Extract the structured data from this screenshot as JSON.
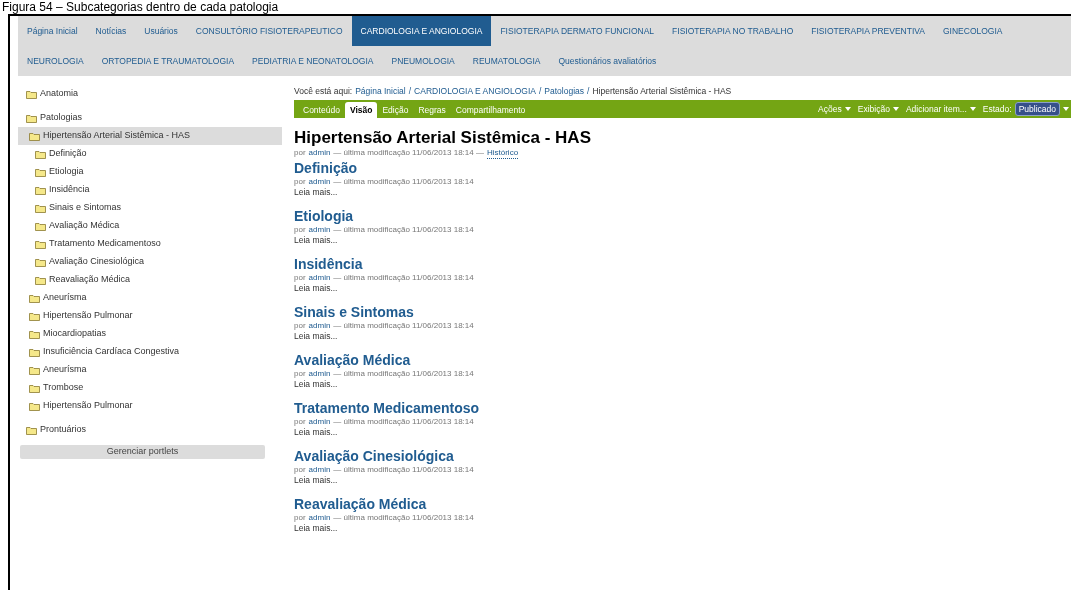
{
  "caption": "Figura 54 – Subcategorias dentro de cada patologia",
  "nav": [
    [
      {
        "label": "Página Inicial",
        "selected": false
      },
      {
        "label": "Notícias",
        "selected": false
      },
      {
        "label": "Usuários",
        "selected": false
      },
      {
        "label": "CONSULTÓRIO FISIOTERAPEUTICO",
        "selected": false
      },
      {
        "label": "CARDIOLOGIA E ANGIOLOGIA",
        "selected": true
      },
      {
        "label": "FISIOTERAPIA DERMATO FUNCIONAL",
        "selected": false
      },
      {
        "label": "FISIOTERAPIA NO TRABALHO",
        "selected": false
      },
      {
        "label": "FISIOTERAPIA PREVENTIVA",
        "selected": false
      },
      {
        "label": "GINECOLOGIA",
        "selected": false
      }
    ],
    [
      {
        "label": "NEUROLOGIA",
        "selected": false
      },
      {
        "label": "ORTOPEDIA E TRAUMATOLOGIA",
        "selected": false
      },
      {
        "label": "PEDIATRIA E NEONATOLOGIA",
        "selected": false
      },
      {
        "label": "PNEUMOLOGIA",
        "selected": false
      },
      {
        "label": "REUMATOLOGIA",
        "selected": false
      },
      {
        "label": "Questionários avaliatórios",
        "selected": false
      }
    ]
  ],
  "sidebar": {
    "tree": [
      {
        "label": "Anatomia",
        "selected": false
      },
      {
        "label": "Patologias",
        "selected": false,
        "children": [
          {
            "label": "Hipertensão Arterial Sistêmica - HAS",
            "selected": true,
            "children": [
              {
                "label": "Definição",
                "selected": false
              },
              {
                "label": "Etiologia",
                "selected": false
              },
              {
                "label": "Insidência",
                "selected": false
              },
              {
                "label": "Sinais e Sintomas",
                "selected": false
              },
              {
                "label": "Avaliação Médica",
                "selected": false
              },
              {
                "label": "Tratamento Medicamentoso",
                "selected": false
              },
              {
                "label": "Avaliação Cinesiológica",
                "selected": false
              },
              {
                "label": "Reavaliação Médica",
                "selected": false
              }
            ]
          },
          {
            "label": "Aneurísma",
            "selected": false
          },
          {
            "label": "Hipertensão Pulmonar",
            "selected": false
          },
          {
            "label": "Miocardiopatias",
            "selected": false
          },
          {
            "label": "Insuficiência Cardíaca Congestiva",
            "selected": false
          },
          {
            "label": "Aneurísma",
            "selected": false
          },
          {
            "label": "Trombose",
            "selected": false
          },
          {
            "label": "Hipertensão Pulmonar",
            "selected": false
          }
        ]
      },
      {
        "label": "Prontuários",
        "selected": false
      }
    ],
    "manage_button": "Gerenciar portlets"
  },
  "breadcrumb": {
    "label": "Você está aqui:",
    "links": [
      "Página Inicial",
      "CARDIOLOGIA E ANGIOLOGIA",
      "Patologias"
    ],
    "separator": "/",
    "current": "Hipertensão Arterial Sistêmica - HAS"
  },
  "edit_bar": {
    "tabs": [
      {
        "label": "Conteúdo",
        "selected": false
      },
      {
        "label": "Visão",
        "selected": true
      },
      {
        "label": "Edição",
        "selected": false
      },
      {
        "label": "Regras",
        "selected": false
      },
      {
        "label": "Compartilhamento",
        "selected": false
      }
    ],
    "menus": [
      "Ações",
      "Exibição",
      "Adicionar item..."
    ],
    "state_label": "Estado:",
    "state_value": "Publicado"
  },
  "page": {
    "title": "Hipertensão Arterial Sistêmica - HAS",
    "byline": {
      "prefix": "por",
      "author": "admin",
      "modified": "— última modificação 11/06/2013 18:14 —",
      "history": "Histórico"
    },
    "items": [
      {
        "title": "Definição",
        "prefix": "por",
        "author": "admin",
        "modified": "— última modificação 11/06/2013 18:14",
        "more": "Leia mais..."
      },
      {
        "title": "Etiologia",
        "prefix": "por",
        "author": "admin",
        "modified": "— última modificação 11/06/2013 18:14",
        "more": "Leia mais..."
      },
      {
        "title": "Insidência",
        "prefix": "por",
        "author": "admin",
        "modified": "— última modificação 11/06/2013 18:14",
        "more": "Leia mais..."
      },
      {
        "title": "Sinais e Sintomas",
        "prefix": "por",
        "author": "admin",
        "modified": "— última modificação 11/06/2013 18:14",
        "more": "Leia mais..."
      },
      {
        "title": "Avaliação Médica",
        "prefix": "por",
        "author": "admin",
        "modified": "— última modificação 11/06/2013 18:14",
        "more": "Leia mais..."
      },
      {
        "title": "Tratamento Medicamentoso",
        "prefix": "por",
        "author": "admin",
        "modified": "— última modificação 11/06/2013 18:14",
        "more": "Leia mais..."
      },
      {
        "title": "Avaliação Cinesiológica",
        "prefix": "por",
        "author": "admin",
        "modified": "— última modificação 11/06/2013 18:14",
        "more": "Leia mais..."
      },
      {
        "title": "Reavaliação Médica",
        "prefix": "por",
        "author": "admin",
        "modified": "— última modificação 11/06/2013 18:14",
        "more": "Leia mais..."
      }
    ]
  }
}
